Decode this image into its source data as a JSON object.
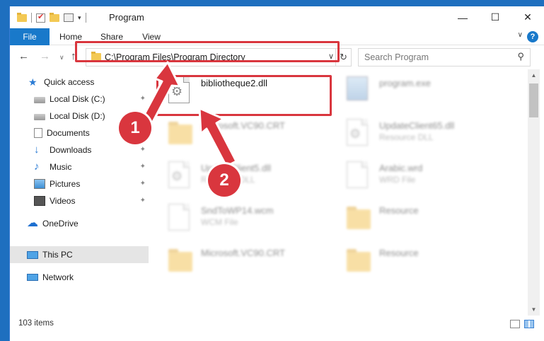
{
  "window": {
    "title": "Program",
    "minimize_glyph": "—",
    "maximize_glyph": "☐",
    "close_glyph": "✕"
  },
  "ribbon": {
    "tabs": [
      "File",
      "Home",
      "Share",
      "View"
    ],
    "help_glyph": "?",
    "collapse_glyph": "∨"
  },
  "nav": {
    "back_glyph": "←",
    "forward_glyph": "→",
    "recent_glyph": "∨",
    "up_glyph": "↑",
    "address_path": "C:\\Program Files\\Program Directory",
    "address_dropdown_glyph": "∨",
    "refresh_glyph": "↻",
    "search_placeholder": "Search Program",
    "search_glyph": "⚲"
  },
  "sidebar": {
    "items": [
      {
        "label": "Quick access",
        "icon": "star-icon",
        "pinned": false
      },
      {
        "label": "Local Disk (C:)",
        "icon": "disk-icon",
        "pinned": true
      },
      {
        "label": "Local Disk (D:)",
        "icon": "disk-icon",
        "pinned": true
      },
      {
        "label": "Documents",
        "icon": "documents-icon",
        "pinned": true
      },
      {
        "label": "Downloads",
        "icon": "downloads-icon",
        "pinned": true
      },
      {
        "label": "Music",
        "icon": "music-icon",
        "pinned": true
      },
      {
        "label": "Pictures",
        "icon": "pictures-icon",
        "pinned": true
      },
      {
        "label": "Videos",
        "icon": "videos-icon",
        "pinned": true
      },
      {
        "label": "OneDrive",
        "icon": "onedrive-icon",
        "pinned": false
      },
      {
        "label": "This PC",
        "icon": "this-pc-icon",
        "pinned": false,
        "selected": true
      },
      {
        "label": "Network",
        "icon": "network-icon",
        "pinned": false
      }
    ],
    "pin_glyph": "📌"
  },
  "files": [
    {
      "name": "bibliotheque2.dll",
      "type": "",
      "icon": "dll-file-icon",
      "highlight": true
    },
    {
      "name": "program.exe",
      "type": "",
      "icon": "exe-file-icon"
    },
    {
      "name": "Microsoft.VC90.CRT",
      "type": "",
      "icon": "folder-icon"
    },
    {
      "name": "UpdateClient65.dll",
      "type": "Resource DLL",
      "icon": "dll-file-icon"
    },
    {
      "name": "UpdateClient5.dll",
      "type": "Resource DLL",
      "icon": "dll-file-icon"
    },
    {
      "name": "Arabic.wrd",
      "type": "WRD File",
      "icon": "file-icon"
    },
    {
      "name": "SndToWP14.wcm",
      "type": "WCM File",
      "icon": "file-icon"
    },
    {
      "name": "Resource",
      "type": "",
      "icon": "folder-icon"
    },
    {
      "name": "Microsoft.VC90.CRT",
      "type": "",
      "icon": "folder-icon"
    },
    {
      "name": "Resource",
      "type": "",
      "icon": "folder-icon"
    }
  ],
  "status": {
    "item_count": "103 items"
  },
  "annotations": {
    "step1": "1",
    "step2": "2",
    "color": "#d9363e"
  }
}
